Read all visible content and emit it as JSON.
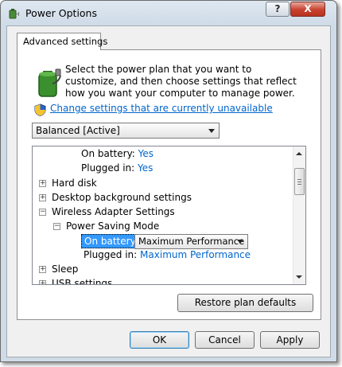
{
  "window": {
    "title": "Power Options",
    "help_label": "?",
    "close_label": "X"
  },
  "tab": {
    "label": "Advanced settings"
  },
  "description": "Select the power plan that you want to customize, and then choose settings that reflect how you want your computer to manage power.",
  "change_settings_link": "Change settings that are currently unavailable",
  "plan_select": {
    "value": "Balanced [Active]"
  },
  "tree": {
    "rows": [
      {
        "key": "on_battery_1",
        "label": "On battery:",
        "value": "Yes"
      },
      {
        "key": "plugged_in_1",
        "label": "Plugged in:",
        "value": "Yes"
      },
      {
        "key": "hard_disk",
        "label": "Hard disk",
        "expander": "+"
      },
      {
        "key": "desktop_bg",
        "label": "Desktop background settings",
        "expander": "+"
      },
      {
        "key": "wireless",
        "label": "Wireless Adapter Settings",
        "expander": "−"
      },
      {
        "key": "power_saving",
        "label": "Power Saving Mode",
        "expander": "−"
      },
      {
        "key": "on_battery_2",
        "label": "On battery:",
        "value": "Maximum Performance"
      },
      {
        "key": "plugged_in_2",
        "label": "Plugged in:",
        "value": "Maximum Performance"
      },
      {
        "key": "sleep",
        "label": "Sleep",
        "expander": "+"
      },
      {
        "key": "usb",
        "label": "USB settings",
        "expander": "+"
      }
    ]
  },
  "restore_button": "Restore plan defaults",
  "buttons": {
    "ok": "OK",
    "cancel": "Cancel",
    "apply": "Apply"
  },
  "colors": {
    "link": "#0066cc",
    "selection": "#3399ff",
    "close_button": "#c8412f"
  },
  "icons": [
    "power-options-app-icon",
    "battery-plug-icon",
    "uac-shield-icon",
    "chevron-down-icon",
    "expand-icon",
    "collapse-icon",
    "scroll-up-icon",
    "scroll-down-icon"
  ]
}
